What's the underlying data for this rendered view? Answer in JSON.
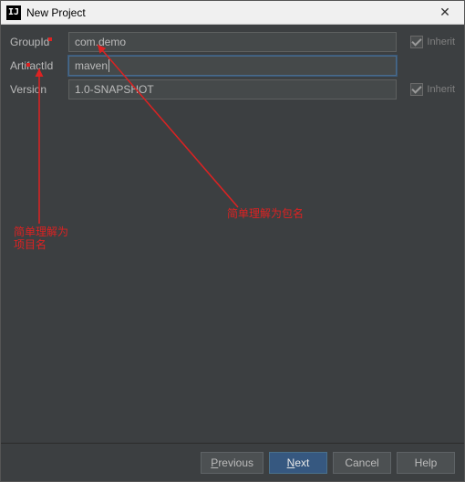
{
  "window": {
    "title": "New Project",
    "close": "✕",
    "appIconText": "IJ"
  },
  "form": {
    "groupId": {
      "label": "GroupId",
      "value": "com.demo",
      "inherit": "Inherit"
    },
    "artifactId": {
      "label": "ArtifactId",
      "value": "maven"
    },
    "version": {
      "label": "Version",
      "value": "1.0-SNAPSHOT",
      "inherit": "Inherit"
    }
  },
  "annotations": {
    "left": "简单理解为\n项目名",
    "right": "简单理解为包名"
  },
  "footer": {
    "previous": "Previous",
    "next": "Next",
    "cancel": "Cancel",
    "help": "Help"
  }
}
